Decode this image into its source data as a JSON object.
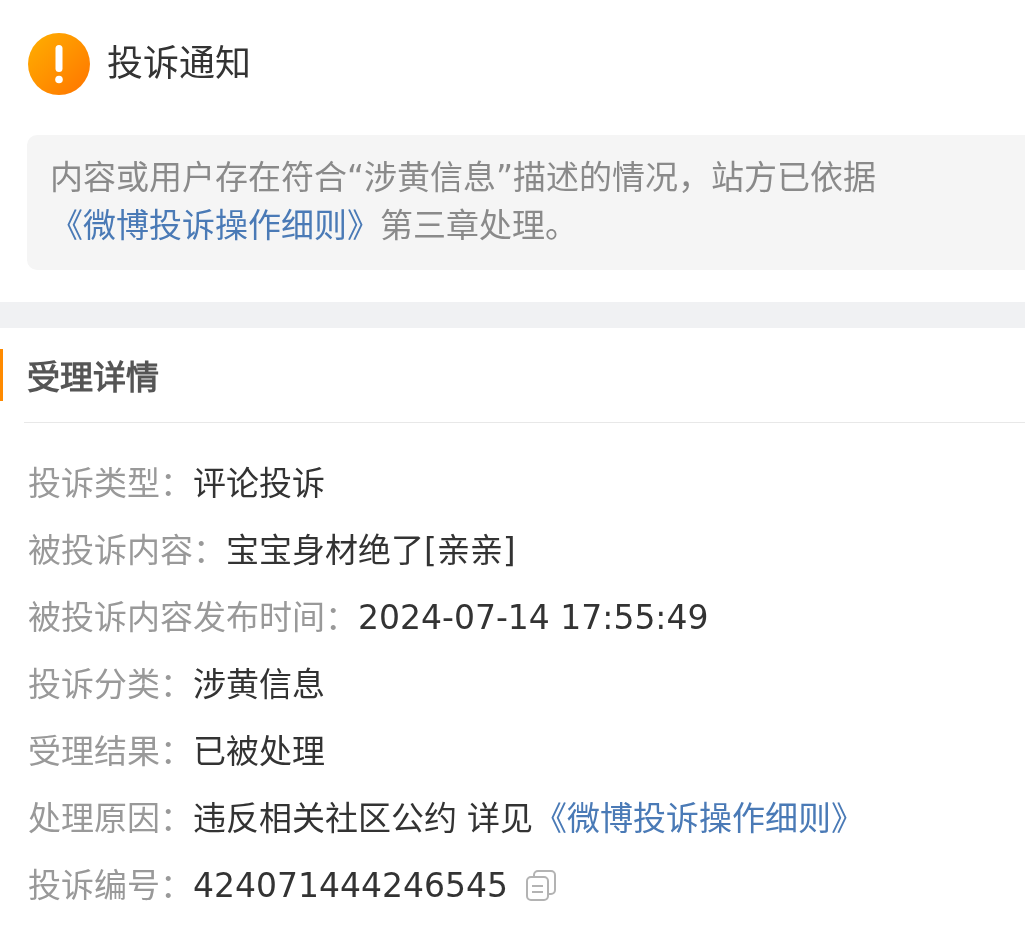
{
  "header": {
    "title": "投诉通知"
  },
  "notice": {
    "segments": [
      {
        "kind": "text",
        "text": "内容或用户存在符合“涉黄信息”描述的情况，站方已依据"
      },
      {
        "kind": "link",
        "text": "《微博投诉操作细则》"
      },
      {
        "kind": "text",
        "text": "第三章处理。"
      }
    ]
  },
  "details": {
    "title": "受理详情",
    "rows": [
      {
        "label": "投诉类型：",
        "value": "评论投诉"
      },
      {
        "label": "被投诉内容：",
        "value": "宝宝身材绝了[亲亲]"
      },
      {
        "label": "被投诉内容发布时间：",
        "value": "2024-07-14 17:55:49"
      },
      {
        "label": "投诉分类：",
        "value": "涉黄信息"
      },
      {
        "label": "受理结果：",
        "value": "已被处理"
      },
      {
        "label": "处理原因：",
        "value": "违反相关社区公约 详见",
        "link": "《微博投诉操作细则》"
      },
      {
        "label": "投诉编号：",
        "value": "424071444246545",
        "copyable": true
      }
    ]
  }
}
